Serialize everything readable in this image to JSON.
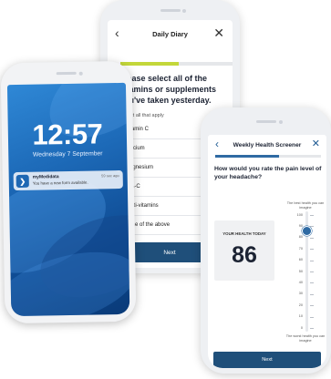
{
  "daily_diary": {
    "title": "Daily Diary",
    "back_icon": "chevron-left-icon",
    "close_icon": "close-icon",
    "progress": 0.5,
    "question": "Please select all of the vitamins or supplements you've taken yesterday.",
    "hint": "Select all that apply",
    "options": [
      "Vitamin C",
      "Calcium",
      "Magnesium",
      "N-A-C",
      "Multi-vitamins",
      "None of the above"
    ],
    "next_label": "Next"
  },
  "lock_screen": {
    "time": "12:57",
    "date": "Wednesday 7 September",
    "notification": {
      "app": "myMedidata",
      "time": "59 sec ago",
      "message": "You have a new form available."
    }
  },
  "health_screener": {
    "title": "Weekly Health Screener",
    "back_icon": "chevron-left-icon",
    "close_icon": "close-icon",
    "progress": 0.6,
    "question": "How would you rate the pain level of your headache?",
    "card_label": "YOUR HEALTH TODAY",
    "value": "86",
    "scale_top_label": "The best health you can imagine",
    "scale_bottom_label": "The worst health you can imagine",
    "scale_ticks": [
      "100",
      "90",
      "80",
      "70",
      "60",
      "50",
      "40",
      "30",
      "20",
      "10",
      "0"
    ],
    "slider_value": 86,
    "next_label": "Next"
  },
  "colors": {
    "primary": "#1f4f7a",
    "accent_green": "#c3d73a",
    "accent_blue": "#2f6aa3"
  }
}
